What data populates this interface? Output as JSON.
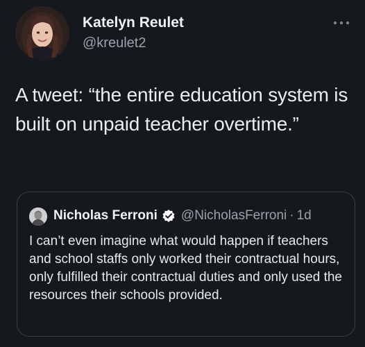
{
  "tweet": {
    "author": {
      "display_name": "Katelyn Reulet",
      "handle": "@kreulet2"
    },
    "text": "A tweet: “the entire education system is built on unpaid teacher overtime.”",
    "more_icon": "more-horizontal-icon"
  },
  "quoted_tweet": {
    "author": {
      "display_name": "Nicholas Ferroni",
      "handle": "@NicholasFerroni",
      "verified": true
    },
    "separator": "·",
    "time": "1d",
    "text": "I can’t even imagine what would happen if teachers and school staffs only worked their contractual hours, only fulfilled their contractual duties and only used the resources their schools provided."
  },
  "colors": {
    "background": "#15181d",
    "text_primary": "#e7e9ea",
    "text_secondary": "#9aa2aa",
    "border": "#3b4046",
    "verified_badge": "#ffffff"
  }
}
